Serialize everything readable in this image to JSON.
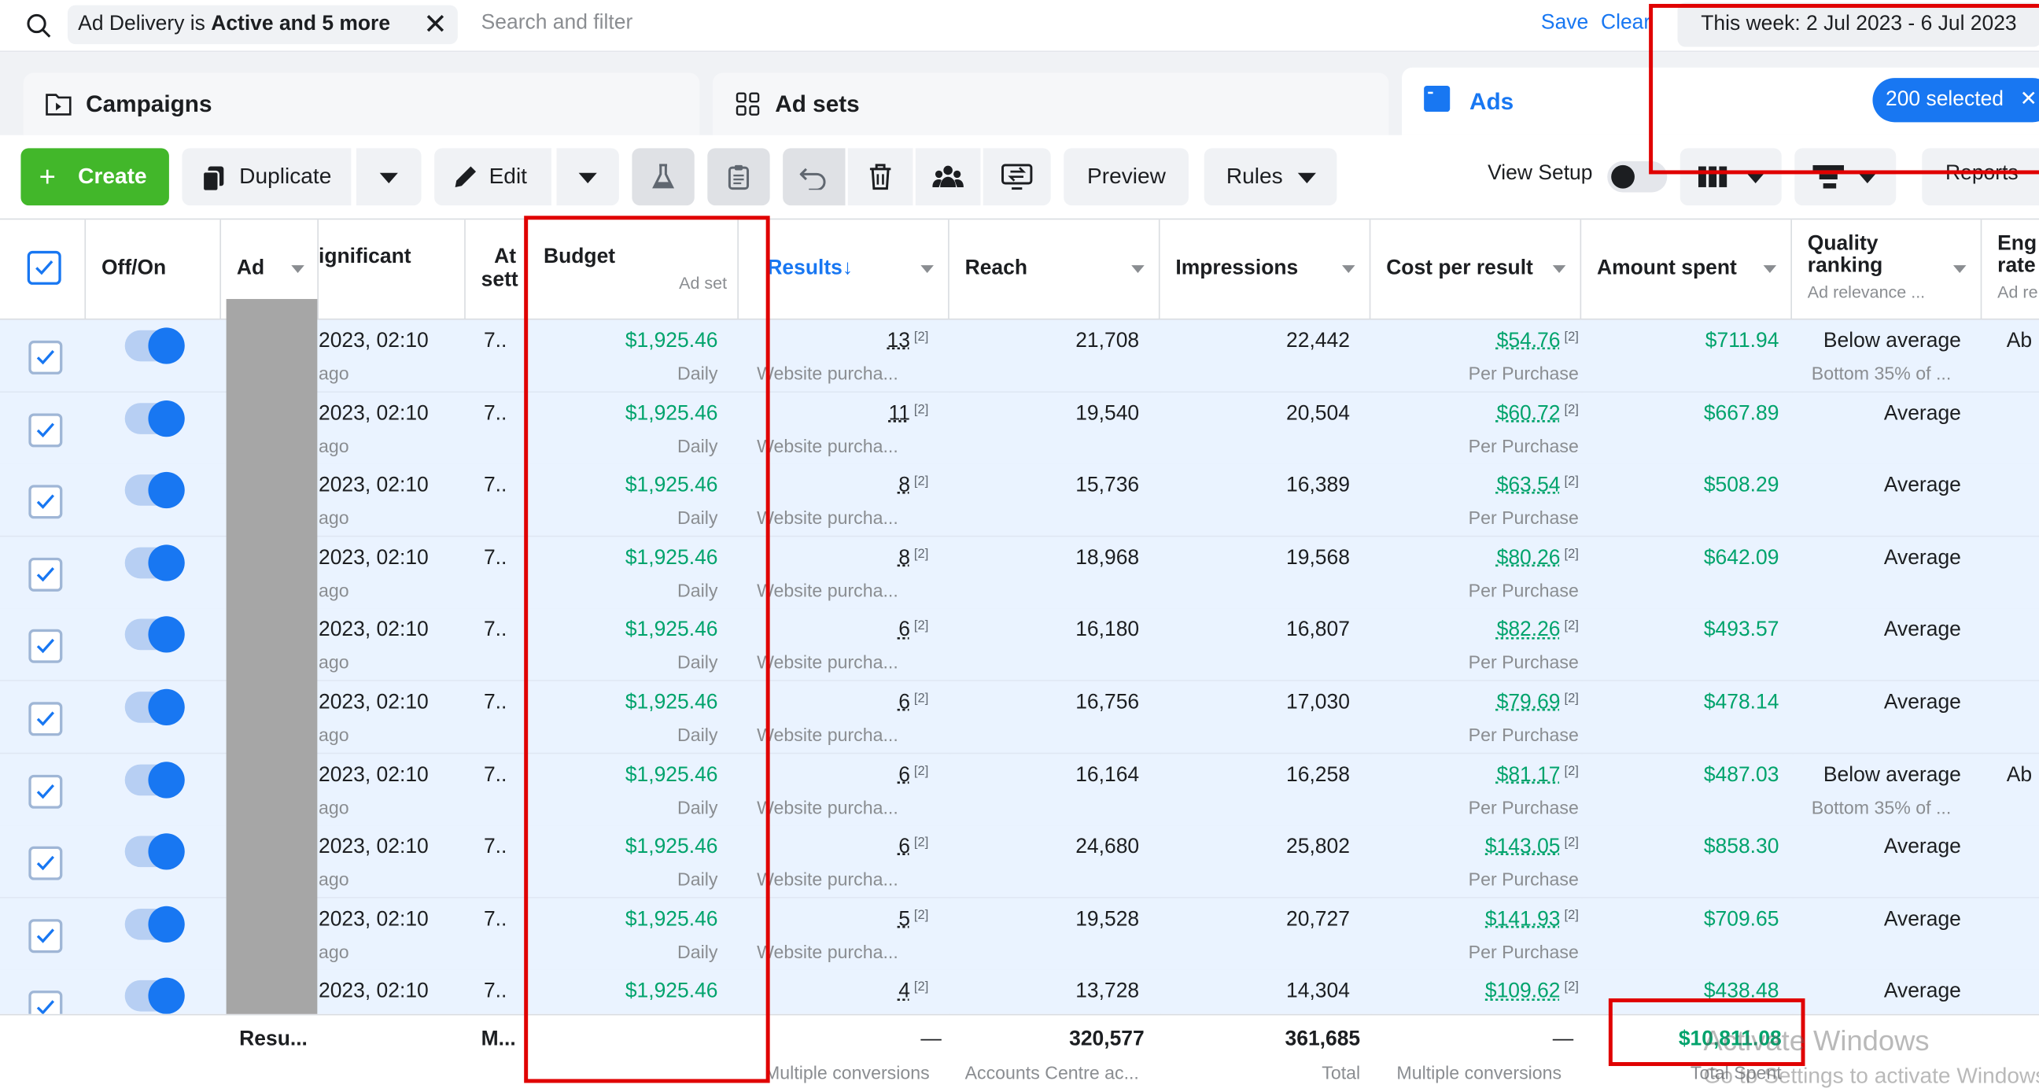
{
  "filter_bar": {
    "chip_prefix": "Ad Delivery is ",
    "chip_bold": "Active and 5 more",
    "search_placeholder": "Search and filter",
    "save": "Save",
    "clear": "Clear",
    "date_range": "This week: 2 Jul 2023 - 6 Jul 2023"
  },
  "tabs": {
    "campaigns": "Campaigns",
    "ad_sets": "Ad sets",
    "ads": "Ads",
    "selected": "200 selected"
  },
  "toolbar": {
    "create": "Create",
    "duplicate": "Duplicate",
    "edit": "Edit",
    "preview": "Preview",
    "rules": "Rules",
    "view_setup": "View Setup",
    "reports": "Reports"
  },
  "columns": {
    "off_on": "Off/On",
    "ad": "Ad",
    "last_significant": "ignificant",
    "attribution": "At",
    "attribution_sub": "sett",
    "budget": "Budget",
    "budget_sub": "Ad set",
    "results": "Results",
    "reach": "Reach",
    "impressions": "Impressions",
    "cost_per_result": "Cost per result",
    "amount_spent": "Amount spent",
    "quality_line1": "Quality",
    "quality_line2": "ranking",
    "quality_sub": "Ad relevance ...",
    "eng_line1": "Eng",
    "eng_line2": "rate",
    "eng_sub": "Ad re"
  },
  "rows": [
    {
      "last_sig": "2023, 02:10",
      "last_sub": "ago",
      "attr": "7..",
      "budget": "$1,925.46",
      "budget_sub": "Daily",
      "results": "13",
      "results_sub": "Website purcha...",
      "reach": "21,708",
      "impressions": "22,442",
      "cpr": "$54.76",
      "cpr_sub": "Per Purchase",
      "spent": "$711.94",
      "quality": "Below average",
      "quality_sub": "Bottom 35% of ...",
      "eng": "Ab"
    },
    {
      "last_sig": "2023, 02:10",
      "last_sub": "ago",
      "attr": "7..",
      "budget": "$1,925.46",
      "budget_sub": "Daily",
      "results": "11",
      "results_sub": "Website purcha...",
      "reach": "19,540",
      "impressions": "20,504",
      "cpr": "$60.72",
      "cpr_sub": "Per Purchase",
      "spent": "$667.89",
      "quality": "Average",
      "quality_sub": "",
      "eng": ""
    },
    {
      "last_sig": "2023, 02:10",
      "last_sub": "ago",
      "attr": "7..",
      "budget": "$1,925.46",
      "budget_sub": "Daily",
      "results": "8",
      "results_sub": "Website purcha...",
      "reach": "15,736",
      "impressions": "16,389",
      "cpr": "$63.54",
      "cpr_sub": "Per Purchase",
      "spent": "$508.29",
      "quality": "Average",
      "quality_sub": "",
      "eng": ""
    },
    {
      "last_sig": "2023, 02:10",
      "last_sub": "ago",
      "attr": "7..",
      "budget": "$1,925.46",
      "budget_sub": "Daily",
      "results": "8",
      "results_sub": "Website purcha...",
      "reach": "18,968",
      "impressions": "19,568",
      "cpr": "$80.26",
      "cpr_sub": "Per Purchase",
      "spent": "$642.09",
      "quality": "Average",
      "quality_sub": "",
      "eng": ""
    },
    {
      "last_sig": "2023, 02:10",
      "last_sub": "ago",
      "attr": "7..",
      "budget": "$1,925.46",
      "budget_sub": "Daily",
      "results": "6",
      "results_sub": "Website purcha...",
      "reach": "16,180",
      "impressions": "16,807",
      "cpr": "$82.26",
      "cpr_sub": "Per Purchase",
      "spent": "$493.57",
      "quality": "Average",
      "quality_sub": "",
      "eng": ""
    },
    {
      "last_sig": "2023, 02:10",
      "last_sub": "ago",
      "attr": "7..",
      "budget": "$1,925.46",
      "budget_sub": "Daily",
      "results": "6",
      "results_sub": "Website purcha...",
      "reach": "16,756",
      "impressions": "17,030",
      "cpr": "$79.69",
      "cpr_sub": "Per Purchase",
      "spent": "$478.14",
      "quality": "Average",
      "quality_sub": "",
      "eng": ""
    },
    {
      "last_sig": "2023, 02:10",
      "last_sub": "ago",
      "attr": "7..",
      "budget": "$1,925.46",
      "budget_sub": "Daily",
      "results": "6",
      "results_sub": "Website purcha...",
      "reach": "16,164",
      "impressions": "16,258",
      "cpr": "$81.17",
      "cpr_sub": "Per Purchase",
      "spent": "$487.03",
      "quality": "Below average",
      "quality_sub": "Bottom 35% of ...",
      "eng": "Ab"
    },
    {
      "last_sig": "2023, 02:10",
      "last_sub": "ago",
      "attr": "7..",
      "budget": "$1,925.46",
      "budget_sub": "Daily",
      "results": "6",
      "results_sub": "Website purcha...",
      "reach": "24,680",
      "impressions": "25,802",
      "cpr": "$143.05",
      "cpr_sub": "Per Purchase",
      "spent": "$858.30",
      "quality": "Average",
      "quality_sub": "",
      "eng": ""
    },
    {
      "last_sig": "2023, 02:10",
      "last_sub": "ago",
      "attr": "7..",
      "budget": "$1,925.46",
      "budget_sub": "Daily",
      "results": "5",
      "results_sub": "Website purcha...",
      "reach": "19,528",
      "impressions": "20,727",
      "cpr": "$141.93",
      "cpr_sub": "Per Purchase",
      "spent": "$709.65",
      "quality": "Average",
      "quality_sub": "",
      "eng": ""
    },
    {
      "last_sig": "2023, 02:10",
      "last_sub": "",
      "attr": "7..",
      "budget": "$1,925.46",
      "budget_sub": "",
      "results": "4",
      "results_sub": "",
      "reach": "13,728",
      "impressions": "14,304",
      "cpr": "$109.62",
      "cpr_sub": "",
      "spent": "$438.48",
      "quality": "Average",
      "quality_sub": "",
      "eng": ""
    }
  ],
  "footnote_marker": "[2]",
  "totals": {
    "ad": "Resu...",
    "attr": "M...",
    "results": "—",
    "results_sub": "Multiple conversions",
    "reach": "320,577",
    "reach_sub": "Accounts Centre ac...",
    "impressions": "361,685",
    "impressions_sub": "Total",
    "cpr": "—",
    "cpr_sub": "Multiple conversions",
    "spent": "$10,811.08",
    "spent_sub": "Total Spent"
  },
  "watermark": {
    "line1": "Activate Windows",
    "line2": "Go to Settings to activate Windows."
  },
  "colors": {
    "accent": "#1877f2",
    "create_green": "#42b72a",
    "money_green": "#00a36c",
    "selected_row": "#eaf3ff",
    "annotation_red": "#e00000"
  }
}
